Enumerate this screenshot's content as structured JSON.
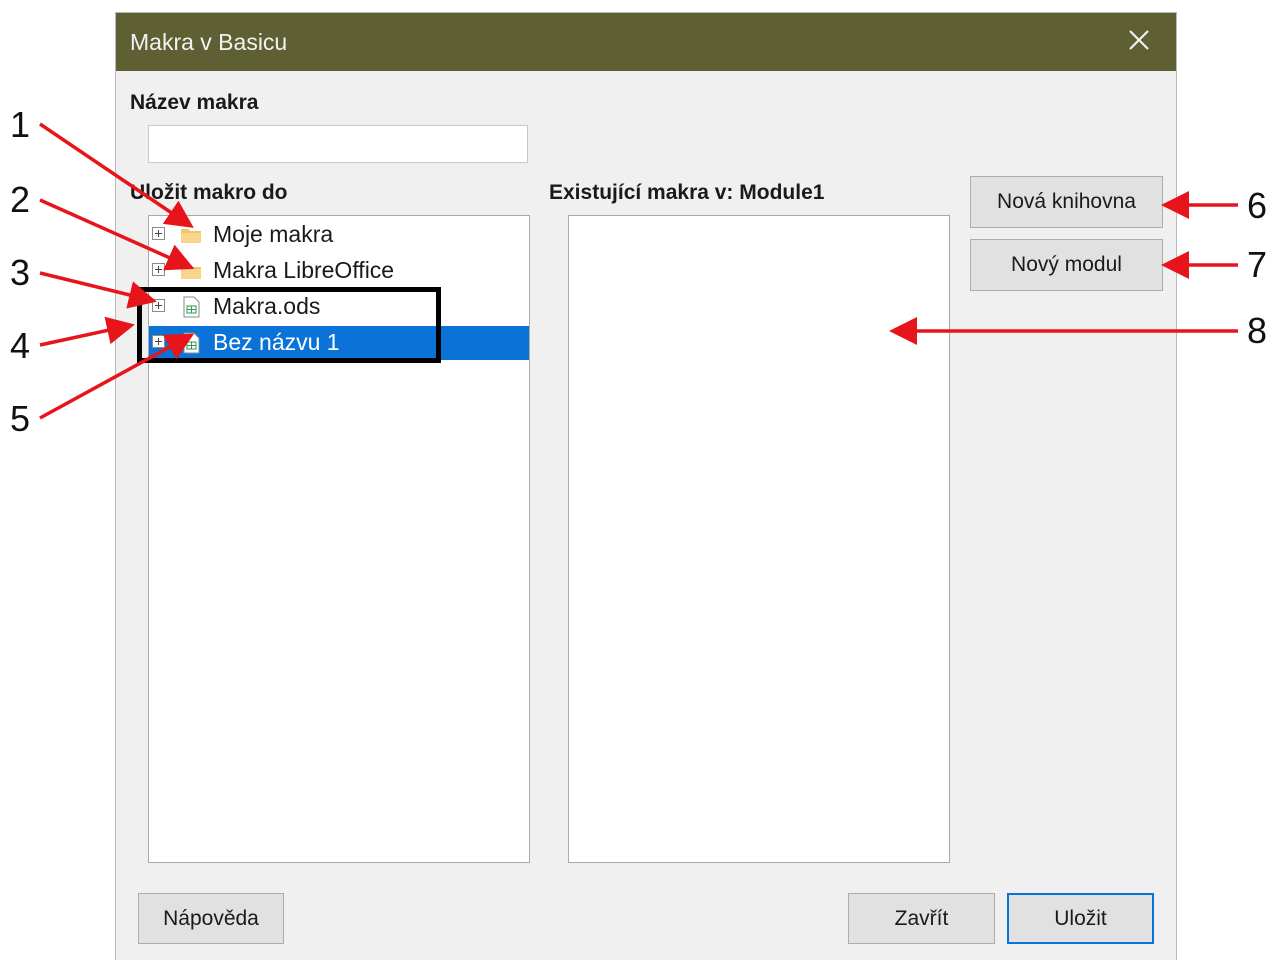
{
  "dialog": {
    "title": "Makra v Basicu",
    "titlebar_color": "#5e5f33",
    "macro_name_label": "Název makra",
    "macro_name_value": "",
    "save_in_label": "Uložit makro do",
    "existing_label": "Existující makra v: Module1",
    "tree_items": [
      {
        "label": "Moje makra",
        "icon": "folder-icon",
        "selected": false
      },
      {
        "label": "Makra LibreOffice",
        "icon": "folder-icon",
        "selected": false
      },
      {
        "label": "Makra.ods",
        "icon": "spreadsheet-document-icon",
        "selected": false
      },
      {
        "label": "Bez názvu 1",
        "icon": "spreadsheet-document-icon",
        "selected": true
      }
    ],
    "existing_macros": [],
    "buttons": {
      "new_library": "Nová knihovna",
      "new_module": "Nový modul",
      "help": "Nápověda",
      "close": "Zavřít",
      "save": "Uložit"
    },
    "selection_color": "#0b72d7"
  },
  "annotations": {
    "numbers": [
      "1",
      "2",
      "3",
      "4",
      "5",
      "6",
      "7",
      "8"
    ],
    "arrow_color": "#e8141b",
    "box_color": "#000000"
  }
}
